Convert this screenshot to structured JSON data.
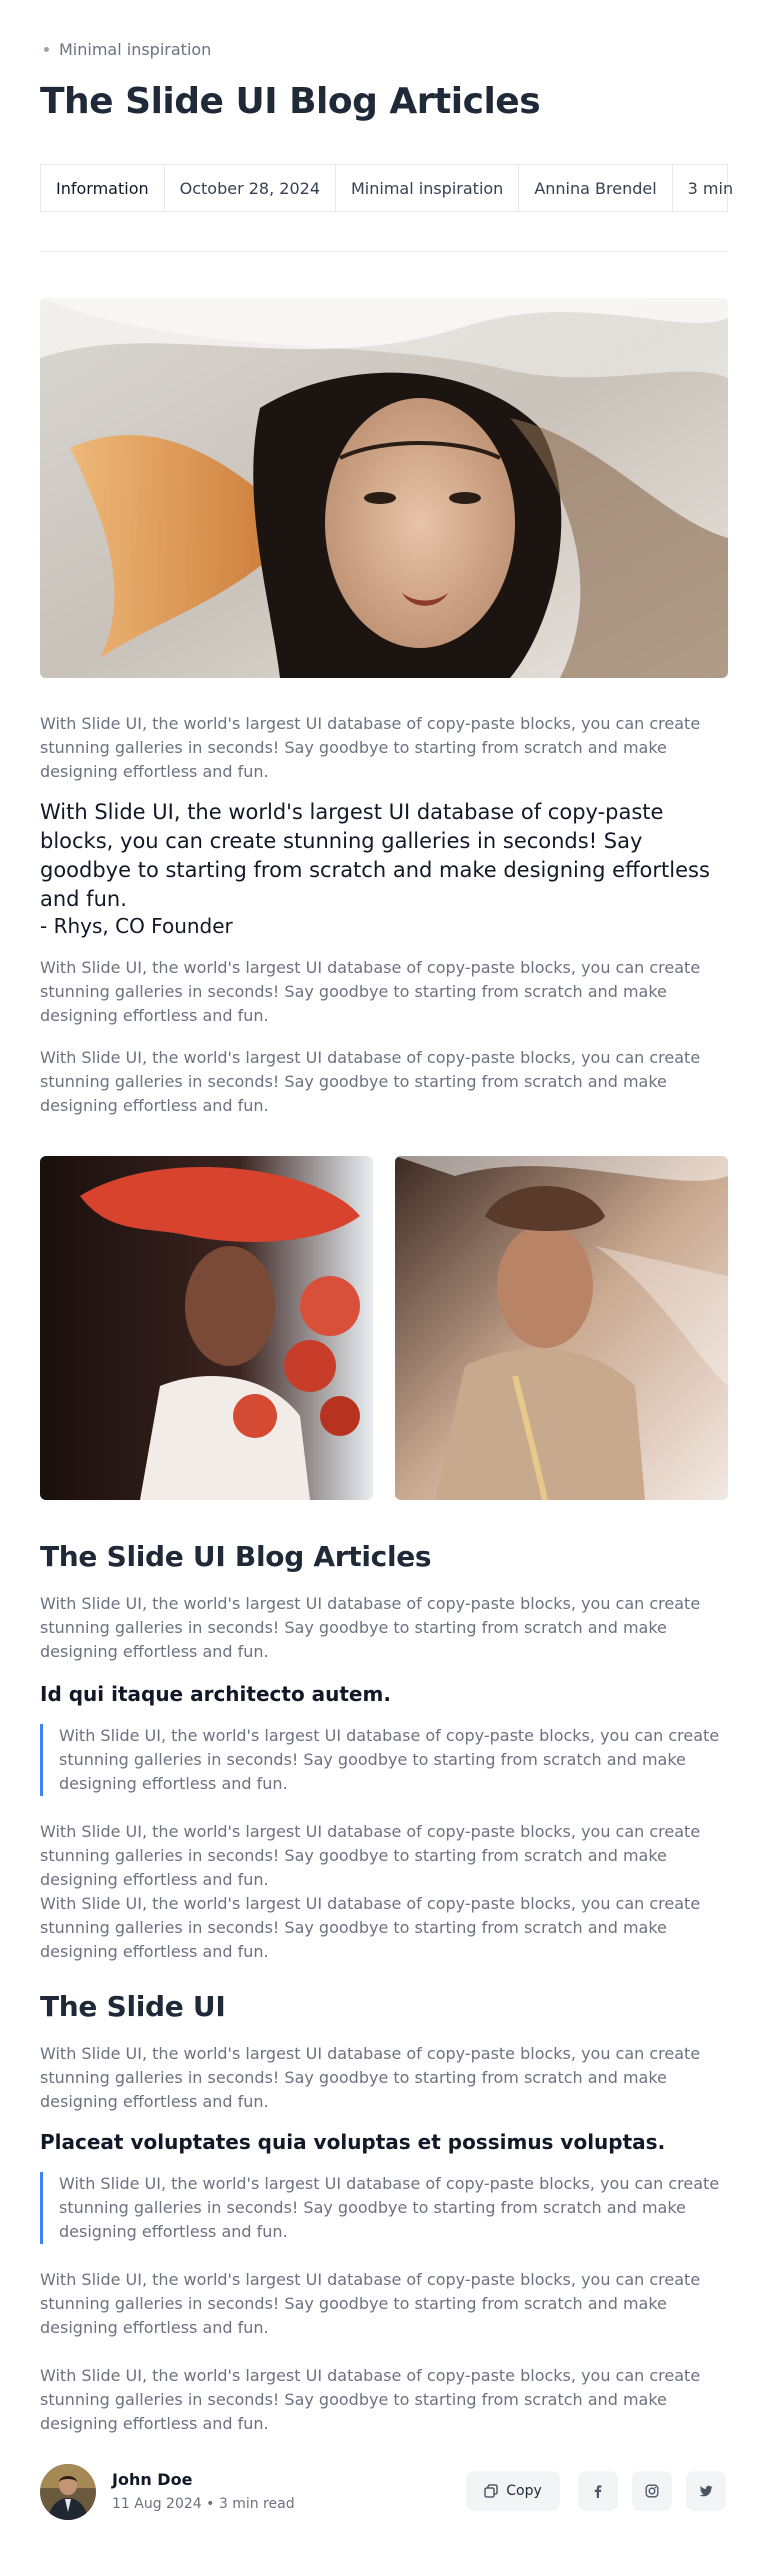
{
  "breadcrumb": {
    "label": "Minimal inspiration"
  },
  "title": "The Slide UI Blog Articles",
  "meta": [
    "Information",
    "October 28, 2024",
    "Minimal inspiration",
    "Annina Brendel",
    "3 min"
  ],
  "intro_text": "With Slide UI, the world's largest UI database of copy-paste blocks, you can create stunning galleries in seconds! Say goodbye to starting from scratch and make designing effortless and fun.",
  "quote": {
    "text": "With Slide UI, the world's largest UI database of copy-paste blocks, you can create stunning galleries in seconds! Say goodbye to starting from scratch and make designing effortless and fun.",
    "author": "- Rhys, CO Founder"
  },
  "paragraphs_1": [
    "With Slide UI, the world's largest UI database of copy-paste blocks, you can create stunning galleries in seconds! Say goodbye to starting from scratch and make designing effortless and fun.",
    "With Slide UI, the world's largest UI database of copy-paste blocks, you can create stunning galleries in seconds! Say goodbye to starting from scratch and make designing effortless and fun."
  ],
  "section_1": {
    "heading": "The Slide UI Blog Articles",
    "text": "With Slide UI, the world's largest UI database of copy-paste blocks, you can create stunning galleries in seconds! Say goodbye to starting from scratch and make designing effortless and fun.",
    "subheading": "Id qui itaque architecto autem.",
    "blockquote": "With Slide UI, the world's largest UI database of copy-paste blocks, you can create stunning galleries in seconds! Say goodbye to starting from scratch and make designing effortless and fun.",
    "paragraphs": [
      "With Slide UI, the world's largest UI database of copy-paste blocks, you can create stunning galleries in seconds! Say goodbye to starting from scratch and make designing effortless and fun.",
      "With Slide UI, the world's largest UI database of copy-paste blocks, you can create stunning galleries in seconds! Say goodbye to starting from scratch and make designing effortless and fun."
    ]
  },
  "section_2": {
    "heading": "The Slide UI",
    "text": "With Slide UI, the world's largest UI database of copy-paste blocks, you can create stunning galleries in seconds! Say goodbye to starting from scratch and make designing effortless and fun.",
    "subheading": "Placeat voluptates quia voluptas et possimus voluptas.",
    "blockquote": "With Slide UI, the world's largest UI database of copy-paste blocks, you can create stunning galleries in seconds! Say goodbye to starting from scratch and make designing effortless and fun.",
    "paragraphs": [
      "With Slide UI, the world's largest UI database of copy-paste blocks, you can create stunning galleries in seconds! Say goodbye to starting from scratch and make designing effortless and fun.",
      "With Slide UI, the world's largest UI database of copy-paste blocks, you can create stunning galleries in seconds! Say goodbye to starting from scratch and make designing effortless and fun."
    ]
  },
  "author": {
    "name": "John Doe",
    "meta": "11 Aug 2024 • 3 min read"
  },
  "share": {
    "copy_label": "Copy",
    "icons": [
      "facebook-icon",
      "instagram-icon",
      "twitter-icon"
    ]
  },
  "colors": {
    "accent": "#3b82f6",
    "text": "#1f2937",
    "muted": "#6b7280",
    "border": "#e5e7eb"
  }
}
